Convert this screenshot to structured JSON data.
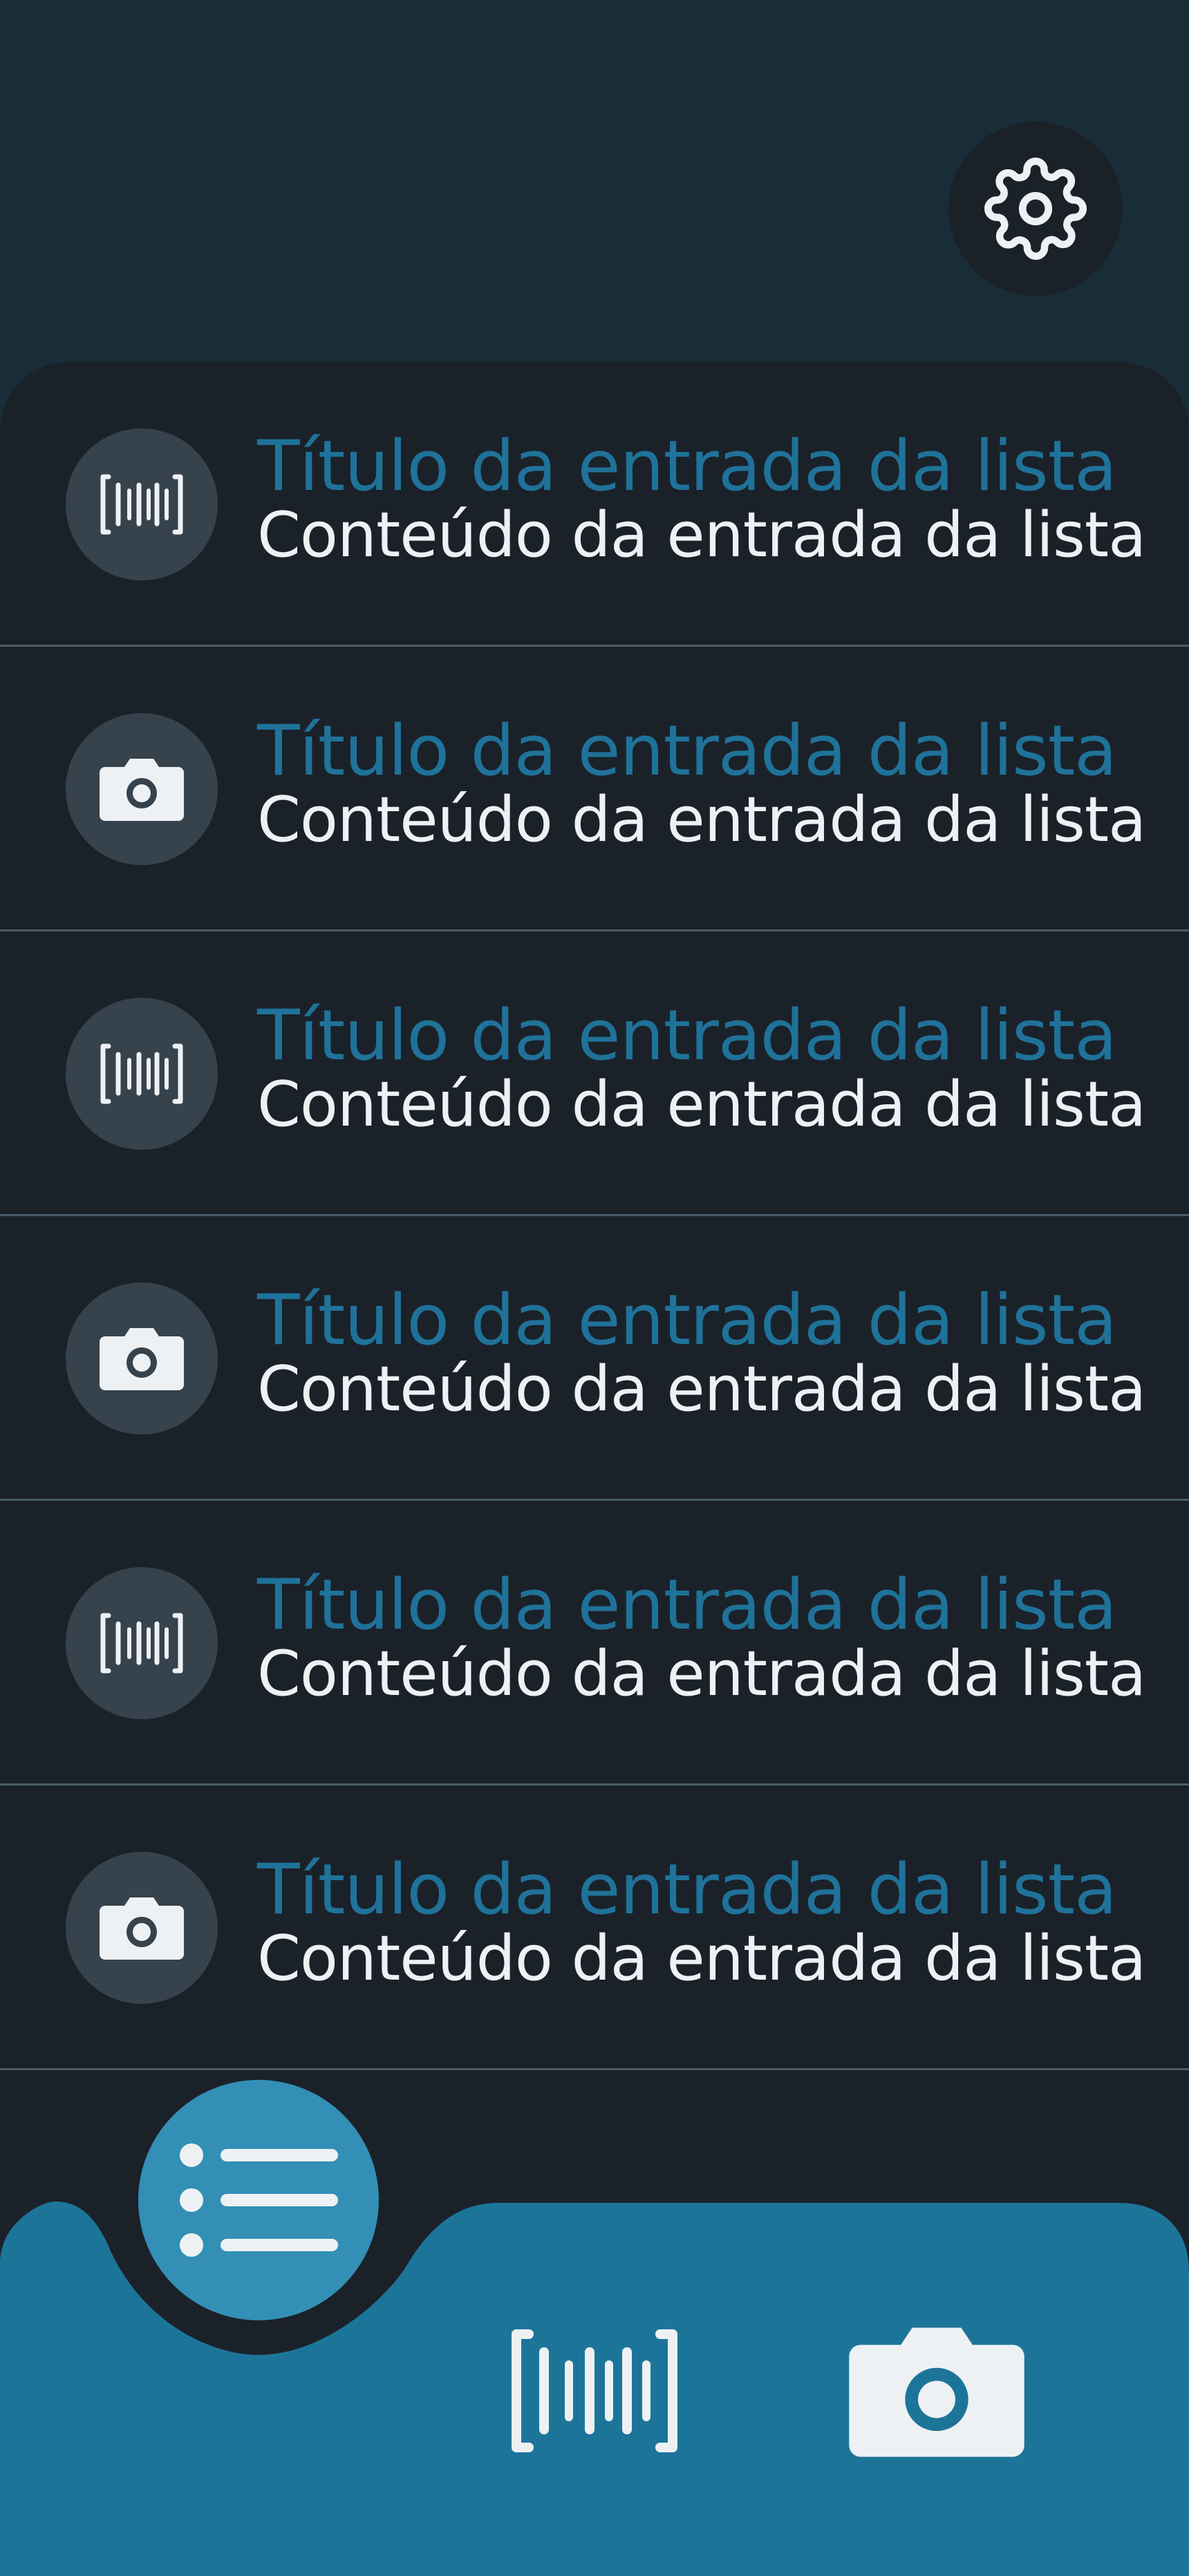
{
  "header": {
    "settings_icon": "gear-icon"
  },
  "colors": {
    "background_top": "#192d38",
    "panel": "#1b2129",
    "icon_circle": "#36424c",
    "title_text": "#1f7299",
    "content_text": "#eef1f4",
    "divider": "#4a5c69",
    "bottom_bar": "#1c7599",
    "fab": "#338fb5"
  },
  "list": {
    "items": [
      {
        "icon": "barcode-icon",
        "title": "Título da entrada da lista",
        "content": "Conteúdo da entrada da lista"
      },
      {
        "icon": "camera-icon",
        "title": "Título da entrada da lista",
        "content": "Conteúdo da entrada da lista"
      },
      {
        "icon": "barcode-icon",
        "title": "Título da entrada da lista",
        "content": "Conteúdo da entrada da lista"
      },
      {
        "icon": "camera-icon",
        "title": "Título da entrada da lista",
        "content": "Conteúdo da entrada da lista"
      },
      {
        "icon": "barcode-icon",
        "title": "Título da entrada da lista",
        "content": "Conteúdo da entrada da lista"
      },
      {
        "icon": "camera-icon",
        "title": "Título da entrada da lista",
        "content": "Conteúdo da entrada da lista"
      }
    ]
  },
  "bottom_nav": {
    "fab_icon": "list-icon",
    "buttons": [
      {
        "icon": "barcode-icon"
      },
      {
        "icon": "camera-icon"
      }
    ]
  }
}
